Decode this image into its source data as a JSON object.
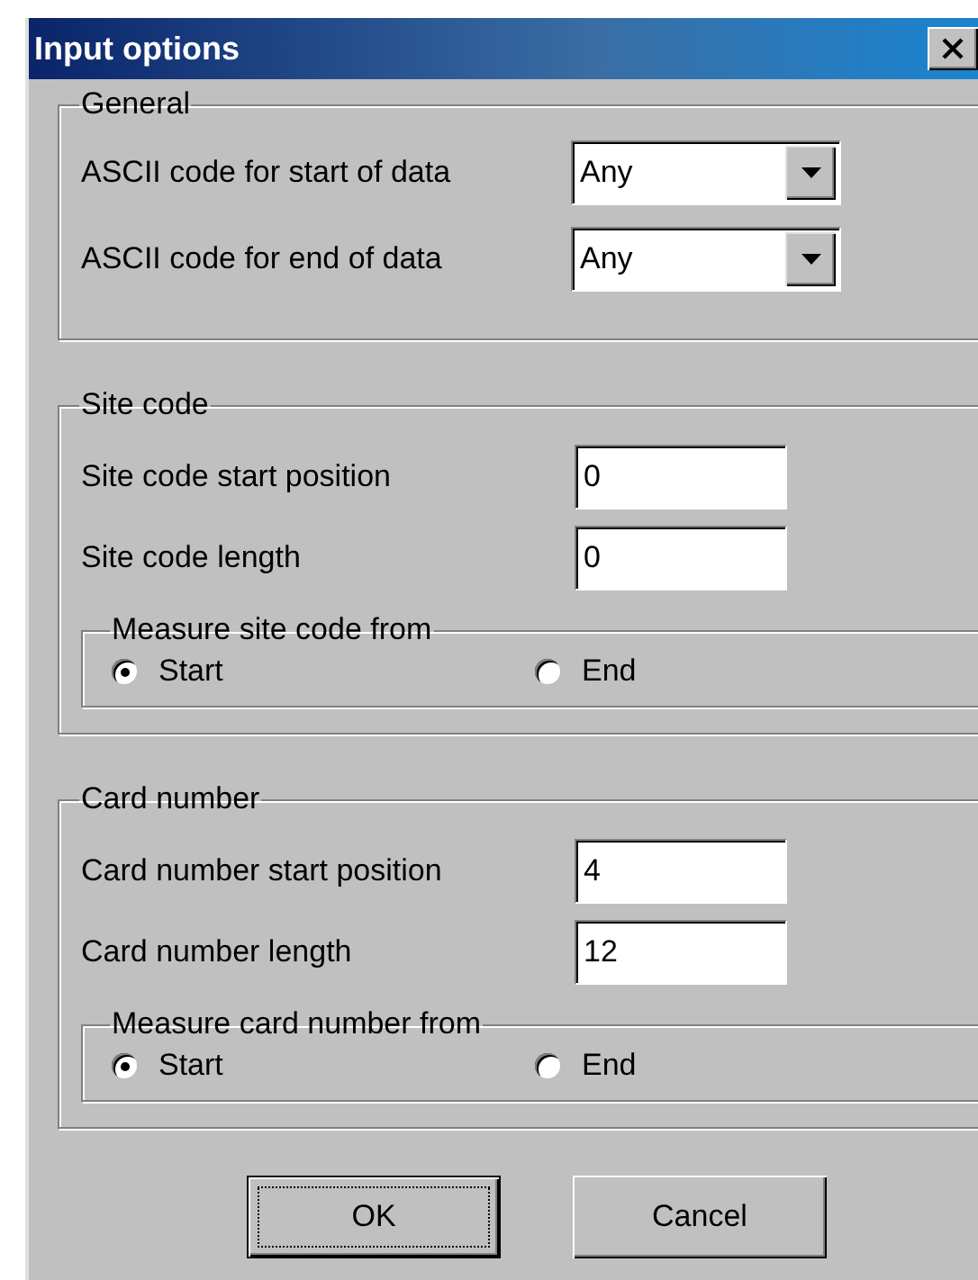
{
  "window": {
    "title": "Input options"
  },
  "groups": [
    {
      "title": "General",
      "fields": [
        {
          "kind": "dropdown",
          "label": "ASCII code for start of data",
          "value": "Any"
        },
        {
          "kind": "dropdown",
          "label": "ASCII code for end of data",
          "value": "Any"
        }
      ]
    },
    {
      "title": "Site code",
      "fields": [
        {
          "kind": "text",
          "label": "Site code start position",
          "value": "0"
        },
        {
          "kind": "text",
          "label": "Site code length",
          "value": "0"
        }
      ],
      "radio_group": {
        "title": "Measure site code from",
        "options": [
          {
            "label": "Start",
            "selected": true
          },
          {
            "label": "End",
            "selected": false
          }
        ]
      }
    },
    {
      "title": "Card number",
      "fields": [
        {
          "kind": "text",
          "label": "Card number start position",
          "value": "4"
        },
        {
          "kind": "text",
          "label": "Card number length",
          "value": "12"
        }
      ],
      "radio_group": {
        "title": "Measure card number from",
        "options": [
          {
            "label": "Start",
            "selected": true
          },
          {
            "label": "End",
            "selected": false
          }
        ]
      }
    }
  ],
  "buttons": [
    {
      "label": "OK",
      "default": true
    },
    {
      "label": "Cancel",
      "default": false
    }
  ]
}
